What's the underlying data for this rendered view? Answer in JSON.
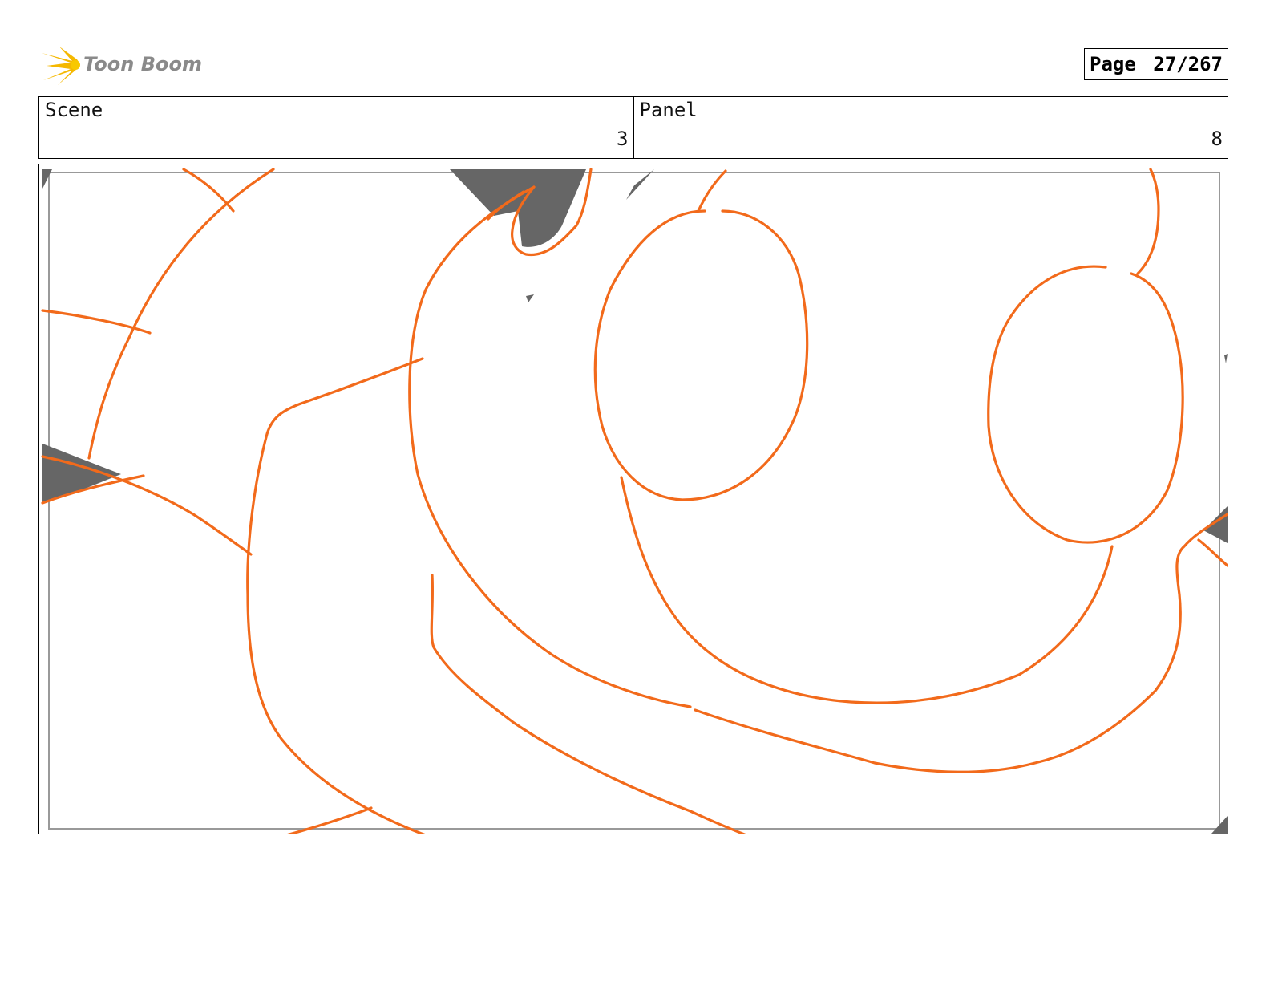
{
  "logo": {
    "text": "Toon Boom",
    "icon": "starburst-logo-icon"
  },
  "page": {
    "label": "Page",
    "value": "27/267"
  },
  "scene": {
    "label": "Scene",
    "value": "3"
  },
  "panel": {
    "label": "Panel",
    "value": "8"
  },
  "colors": {
    "stroke": "#f26a1b",
    "shadow": "#666666",
    "frame": "#999999",
    "logo": "#f5b800"
  }
}
